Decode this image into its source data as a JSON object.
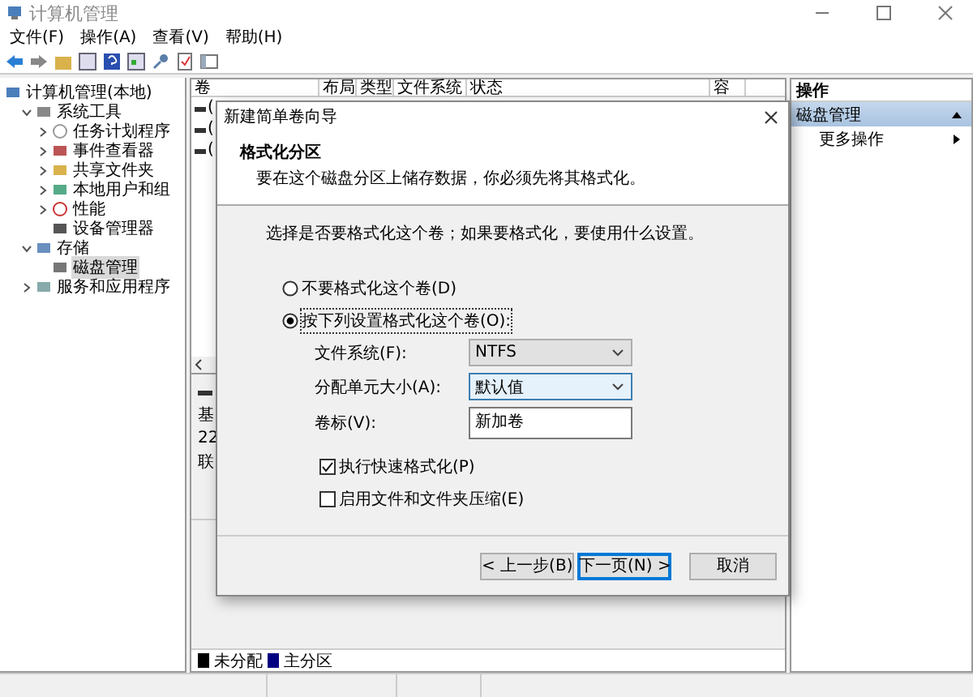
{
  "window": {
    "title": "计算机管理"
  },
  "menu": [
    "文件(F)",
    "操作(A)",
    "查看(V)",
    "帮助(H)"
  ],
  "tree": [
    {
      "label": "计算机管理(本地)",
      "selected": false,
      "children": [
        {
          "label": "系统工具",
          "expanded": true,
          "selected": false,
          "children": [
            {
              "label": "任务计划程序",
              "expanded": false,
              "selected": false
            },
            {
              "label": "事件查看器",
              "expanded": false,
              "selected": false
            },
            {
              "label": "共享文件夹",
              "expanded": false,
              "selected": false
            },
            {
              "label": "本地用户和组",
              "expanded": false,
              "selected": false
            },
            {
              "label": "性能",
              "expanded": false,
              "selected": false
            },
            {
              "label": "设备管理器",
              "selected": false
            }
          ]
        },
        {
          "label": "存储",
          "expanded": true,
          "selected": false,
          "children": [
            {
              "label": "磁盘管理",
              "selected": true
            }
          ]
        },
        {
          "label": "服务和应用程序",
          "expanded": false,
          "selected": false
        }
      ]
    }
  ],
  "volumes": {
    "columns": [
      "卷",
      "布局",
      "类型",
      "文件系统",
      "状态",
      "容"
    ],
    "rows": [
      "(",
      "(",
      "("
    ]
  },
  "disk": {
    "lines": [
      "基",
      "22",
      "联"
    ]
  },
  "legend": [
    {
      "label": "未分配",
      "color": "#000000"
    },
    {
      "label": "主分区",
      "color": "#000080"
    }
  ],
  "actions": {
    "header": "操作",
    "items": [
      {
        "label": "磁盘管理",
        "kind": "section"
      },
      {
        "label": "更多操作",
        "kind": "submenu"
      }
    ]
  },
  "dialog": {
    "title": "新建简单卷向导",
    "heading": "格式化分区",
    "subtitle": "要在这个磁盘分区上储存数据，你必须先将其格式化。",
    "prompt": "选择是否要格式化这个卷；如果要格式化，要使用什么设置。",
    "options": [
      {
        "label": "不要格式化这个卷(D)",
        "selected": false
      },
      {
        "label": "按下列设置格式化这个卷(O):",
        "selected": true
      }
    ],
    "fields": [
      {
        "label": "文件系统(F):",
        "kind": "select",
        "value": "NTFS",
        "focused": false
      },
      {
        "label": "分配单元大小(A):",
        "kind": "select",
        "value": "默认值",
        "focused": true
      },
      {
        "label": "卷标(V):",
        "kind": "text",
        "value": "新加卷",
        "focused": false
      }
    ],
    "checks": [
      {
        "label": "执行快速格式化(P)",
        "checked": true
      },
      {
        "label": "启用文件和文件夹压缩(E)",
        "checked": false
      }
    ],
    "buttons": [
      {
        "label": "< 上一步(B)",
        "focused": false
      },
      {
        "label": "下一页(N) >",
        "focused": true
      },
      {
        "label": "取消",
        "focused": false
      }
    ]
  }
}
